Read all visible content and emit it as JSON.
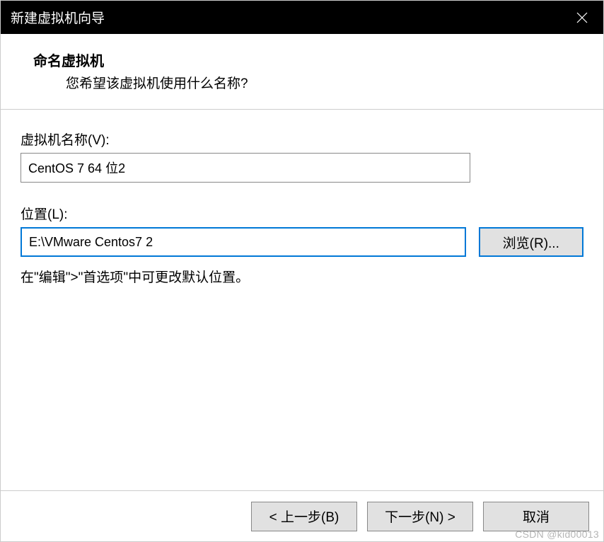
{
  "titlebar": {
    "title": "新建虚拟机向导"
  },
  "header": {
    "heading": "命名虚拟机",
    "subtext": "您希望该虚拟机使用什么名称?"
  },
  "form": {
    "vmname_label": "虚拟机名称(V):",
    "vmname_value": "CentOS 7 64 位2",
    "location_label": "位置(L):",
    "location_value": "E:\\VMware Centos7 2",
    "browse_label": "浏览(R)...",
    "hint": "在\"编辑\">\"首选项\"中可更改默认位置。"
  },
  "footer": {
    "back_label": "< 上一步(B)",
    "next_label": "下一步(N) >",
    "cancel_label": "取消"
  },
  "watermark": "CSDN @kid00013"
}
